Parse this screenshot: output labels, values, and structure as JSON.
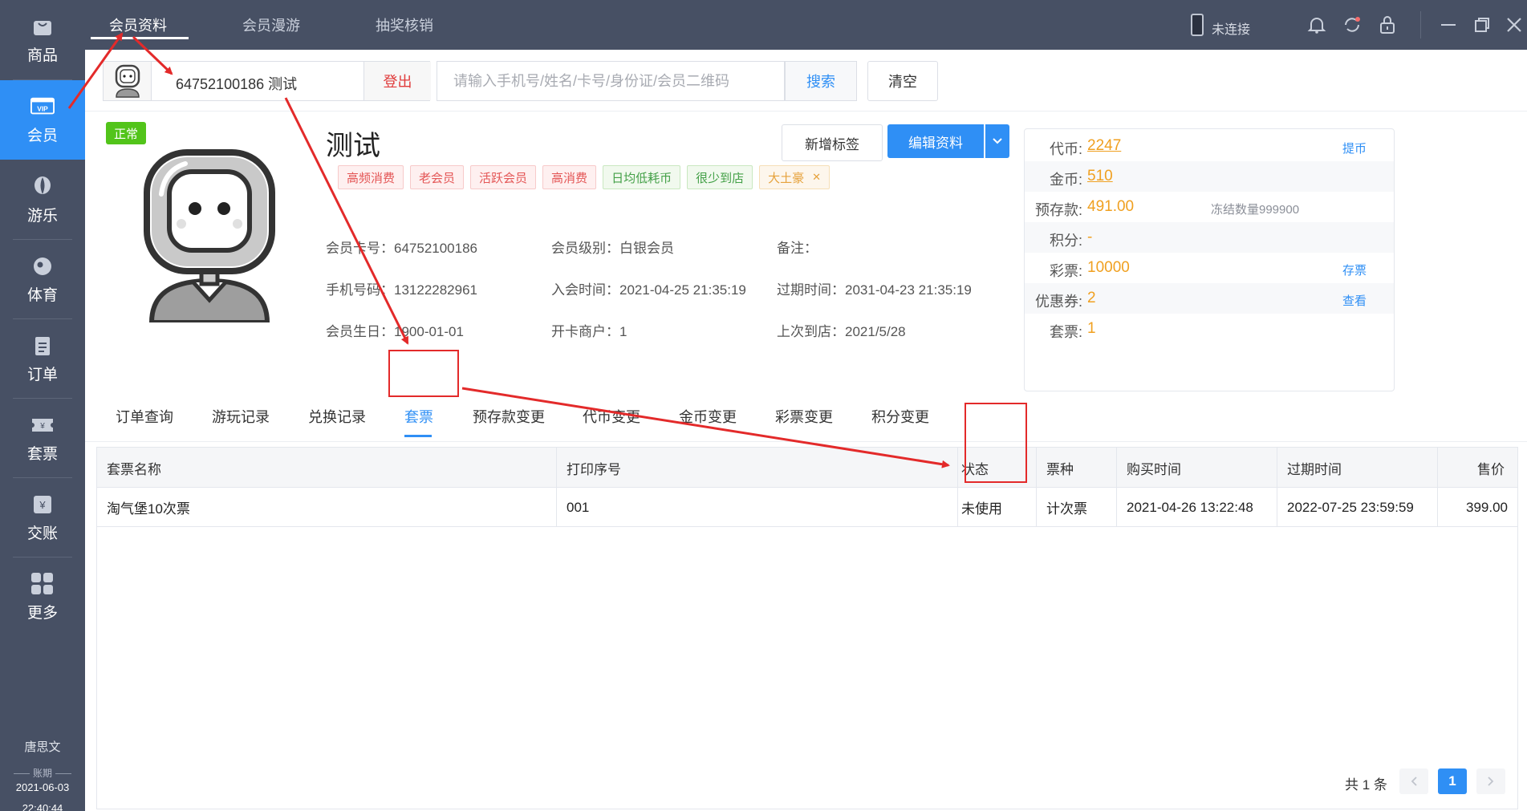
{
  "sidebar": {
    "items": [
      {
        "label": "商品",
        "icon": "bag-icon"
      },
      {
        "label": "会员",
        "icon": "vip-icon"
      },
      {
        "label": "游乐",
        "icon": "balloon-icon"
      },
      {
        "label": "体育",
        "icon": "ball-icon"
      },
      {
        "label": "订单",
        "icon": "clipboard-icon"
      },
      {
        "label": "套票",
        "icon": "ticket-icon"
      },
      {
        "label": "交账",
        "icon": "yen-icon"
      },
      {
        "label": "更多",
        "icon": "grid-icon"
      }
    ],
    "active_index": 1,
    "user": "唐思文",
    "period_label": "账期",
    "period_date": "2021-06-03",
    "time": "22:40:44"
  },
  "topbar": {
    "tabs": [
      "会员资料",
      "会员漫游",
      "抽奖核销"
    ],
    "active_tab": 0,
    "connection": "未连接"
  },
  "search": {
    "member_text": "64752100186  测试",
    "logout": "登出",
    "placeholder": "请输入手机号/姓名/卡号/身份证/会员二维码",
    "search_btn": "搜索",
    "clear_btn": "清空"
  },
  "profile": {
    "status": "正常",
    "name": "测试",
    "tags": [
      {
        "text": "高频消费",
        "color": "red"
      },
      {
        "text": "老会员",
        "color": "red"
      },
      {
        "text": "活跃会员",
        "color": "red"
      },
      {
        "text": "高消费",
        "color": "red"
      },
      {
        "text": "日均低耗币",
        "color": "green"
      },
      {
        "text": "很少到店",
        "color": "green"
      },
      {
        "text": "大土豪",
        "color": "orange",
        "closable": true
      }
    ],
    "add_tag": "新增标签",
    "edit": "编辑资料",
    "card_no": "会员卡号：64752100186",
    "level": "会员级别：白银会员",
    "remark": "备注：",
    "phone": "手机号码：13122282961",
    "join_time": "入会时间：2021-04-25 21:35:19",
    "expire_time": "过期时间：2031-04-23 21:35:19",
    "birthday": "会员生日：1900-01-01",
    "merchant": "开卡商户：1",
    "last_visit": "上次到店：2021/5/28"
  },
  "assets": [
    {
      "label": "代币:",
      "value": "2247",
      "underline": true,
      "link": "提币"
    },
    {
      "label": "金币:",
      "value": "510",
      "underline": true
    },
    {
      "label": "预存款:",
      "value": "491.00",
      "note": "冻结数量999900"
    },
    {
      "label": "积分:",
      "value": "-"
    },
    {
      "label": "彩票:",
      "value": "10000",
      "link": "存票"
    },
    {
      "label": "优惠券:",
      "value": "2",
      "link": "查看"
    },
    {
      "label": "套票:",
      "value": "1"
    }
  ],
  "subtabs": [
    "订单查询",
    "游玩记录",
    "兑换记录",
    "套票",
    "预存款变更",
    "代币变更",
    "金币变更",
    "彩票变更",
    "积分变更"
  ],
  "active_subtab": 3,
  "table": {
    "headers": [
      "套票名称",
      "打印序号",
      "状态",
      "票种",
      "购买时间",
      "过期时间",
      "售价"
    ],
    "rows": [
      [
        "淘气堡10次票",
        "001",
        "未使用",
        "计次票",
        "2021-04-26 13:22:48",
        "2022-07-25 23:59:59",
        "399.00"
      ]
    ]
  },
  "pagination": {
    "total": "共 1 条",
    "current": "1"
  },
  "colors": {
    "sidebar": "#475064",
    "accent": "#2f8ff5",
    "annotation": "#e32a2a",
    "value": "#f0a020"
  }
}
